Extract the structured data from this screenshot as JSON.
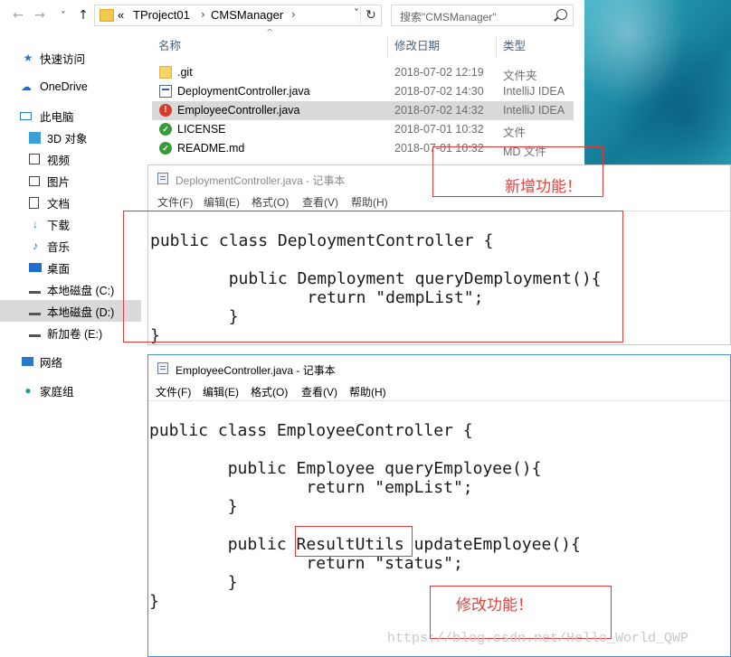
{
  "explorer": {
    "breadcrumb": [
      "TProject01",
      "CMSManager"
    ],
    "breadcrumb_lead": "«",
    "search_placeholder": "搜索\"CMSManager\"",
    "columns": {
      "name": "名称",
      "date": "修改日期",
      "type": "类型"
    },
    "sidebar": [
      {
        "label": "快速访问",
        "icon": "star-icon"
      },
      {
        "label": "OneDrive",
        "icon": "cloud-icon"
      },
      {
        "label": "此电脑",
        "icon": "computer-icon"
      },
      {
        "label": "3D 对象",
        "icon": "cube-icon"
      },
      {
        "label": "视频",
        "icon": "video-icon"
      },
      {
        "label": "图片",
        "icon": "picture-icon"
      },
      {
        "label": "文档",
        "icon": "document-icon"
      },
      {
        "label": "下载",
        "icon": "download-icon"
      },
      {
        "label": "音乐",
        "icon": "music-icon"
      },
      {
        "label": "桌面",
        "icon": "desktop-icon"
      },
      {
        "label": "本地磁盘 (C:)",
        "icon": "drive-icon"
      },
      {
        "label": "本地磁盘 (D:)",
        "icon": "drive-icon"
      },
      {
        "label": "新加卷 (E:)",
        "icon": "drive-icon"
      },
      {
        "label": "网络",
        "icon": "network-icon"
      },
      {
        "label": "家庭组",
        "icon": "homegroup-icon"
      }
    ],
    "files": [
      {
        "name": ".git",
        "date": "2018-07-02 12:19",
        "type": "文件夹",
        "icon": "folder-icon"
      },
      {
        "name": "DeploymentController.java",
        "date": "2018-07-02 14:30",
        "type": "IntelliJ IDEA",
        "icon": "java-file-icon"
      },
      {
        "name": "EmployeeController.java",
        "date": "2018-07-02 14:32",
        "type": "IntelliJ IDEA",
        "icon": "conflict-icon"
      },
      {
        "name": "LICENSE",
        "date": "2018-07-01 10:32",
        "type": "文件",
        "icon": "ok-icon"
      },
      {
        "name": "README.md",
        "date": "2018-07-01 10:32",
        "type": "MD 文件",
        "icon": "ok-icon"
      }
    ]
  },
  "notepad1": {
    "title": "DeploymentController.java - 记事本",
    "menu": [
      "文件(F)",
      "编辑(E)",
      "格式(O)",
      "查看(V)",
      "帮助(H)"
    ],
    "code": [
      "public class DeploymentController {",
      "",
      "        public Demployment queryDemployment(){",
      "                return \"dempList\";",
      "        }",
      "}"
    ],
    "annotation": "新增功能！"
  },
  "notepad2": {
    "title": "EmployeeController.java - 记事本",
    "menu": [
      "文件(F)",
      "编辑(E)",
      "格式(O)",
      "查看(V)",
      "帮助(H)"
    ],
    "code": [
      "public class EmployeeController {",
      "",
      "        public Employee queryEmployee(){",
      "                return \"empList\";",
      "        }",
      "",
      "        public ResultUtils updateEmployee(){",
      "                return \"status\";",
      "        }",
      "}"
    ],
    "annotation": "修改功能！"
  },
  "watermark": "https://blog.csdn.net/Hello_World_QWP",
  "colors": {
    "annotation": "#e8413c",
    "selection": "#d9d9d9",
    "window_border": "#4a90d9"
  }
}
